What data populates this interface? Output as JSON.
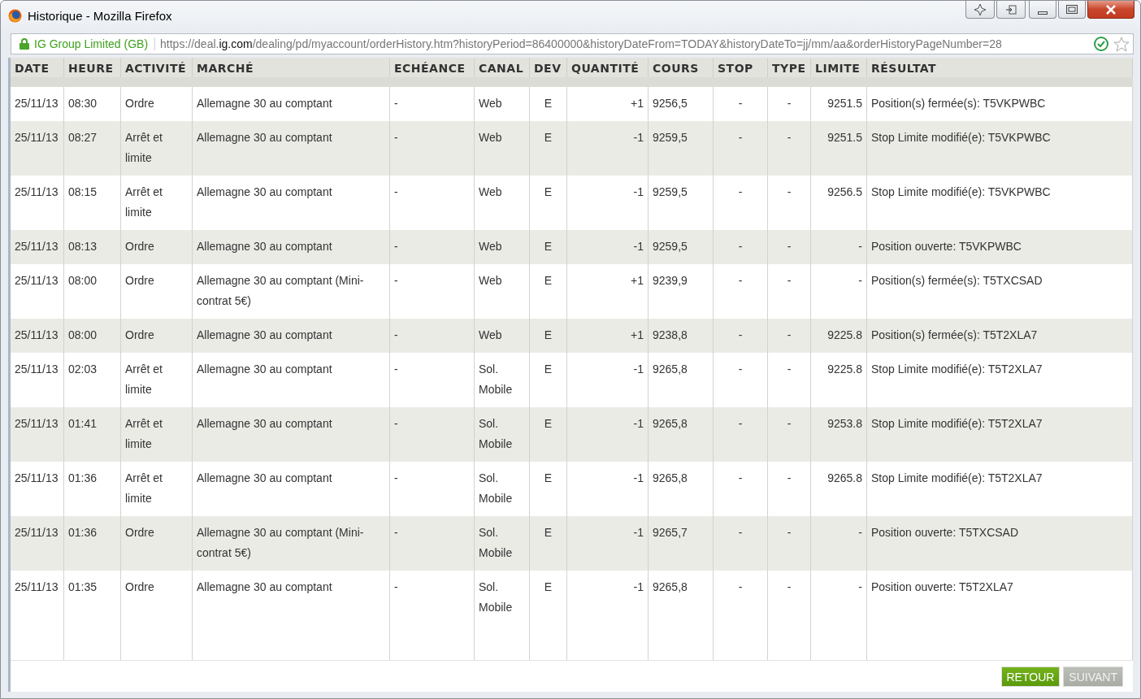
{
  "window": {
    "title": "Historique - Mozilla Firefox"
  },
  "address_bar": {
    "identity": "IG Group Limited (GB)",
    "url_start": "https://deal.",
    "url_domain": "ig.com",
    "url_rest": "/dealing/pd/myaccount/orderHistory.htm?historyPeriod=86400000&historyDateFrom=TODAY&historyDateTo=jj/mm/aa&orderHistoryPageNumber=28"
  },
  "table": {
    "columns": [
      "DATE",
      "HEURE",
      "ACTIVITÉ",
      "MARCHÉ",
      "ECHÉANCE",
      "CANAL",
      "DEV",
      "QUANTITÉ",
      "COURS",
      "STOP",
      "TYPE",
      "LIMITE",
      "RÉSULTAT"
    ],
    "rows": [
      [
        "25/11/13",
        "08:30",
        "Ordre",
        "Allemagne 30 au comptant",
        "-",
        "Web",
        "E",
        "+1",
        "9256,5",
        "-",
        "-",
        "9251.5",
        "Position(s) fermée(s): T5VKPWBC"
      ],
      [
        "25/11/13",
        "08:27",
        "Arrêt et limite",
        "Allemagne 30 au comptant",
        "-",
        "Web",
        "E",
        "-1",
        "9259,5",
        "-",
        "-",
        "9251.5",
        "Stop Limite modifié(e): T5VKPWBC"
      ],
      [
        "25/11/13",
        "08:15",
        "Arrêt et limite",
        "Allemagne 30 au comptant",
        "-",
        "Web",
        "E",
        "-1",
        "9259,5",
        "-",
        "-",
        "9256.5",
        "Stop Limite modifié(e): T5VKPWBC"
      ],
      [
        "25/11/13",
        "08:13",
        "Ordre",
        "Allemagne 30 au comptant",
        "-",
        "Web",
        "E",
        "-1",
        "9259,5",
        "-",
        "-",
        "-",
        "Position ouverte: T5VKPWBC"
      ],
      [
        "25/11/13",
        "08:00",
        "Ordre",
        "Allemagne 30 au comptant (Mini-contrat 5€)",
        "-",
        "Web",
        "E",
        "+1",
        "9239,9",
        "-",
        "-",
        "-",
        "Position(s) fermée(s): T5TXCSAD"
      ],
      [
        "25/11/13",
        "08:00",
        "Ordre",
        "Allemagne 30 au comptant",
        "-",
        "Web",
        "E",
        "+1",
        "9238,8",
        "-",
        "-",
        "9225.8",
        "Position(s) fermée(s): T5T2XLA7"
      ],
      [
        "25/11/13",
        "02:03",
        "Arrêt et limite",
        "Allemagne 30 au comptant",
        "-",
        "Sol. Mobile",
        "E",
        "-1",
        "9265,8",
        "-",
        "-",
        "9225.8",
        "Stop Limite modifié(e): T5T2XLA7"
      ],
      [
        "25/11/13",
        "01:41",
        "Arrêt et limite",
        "Allemagne 30 au comptant",
        "-",
        "Sol. Mobile",
        "E",
        "-1",
        "9265,8",
        "-",
        "-",
        "9253.8",
        "Stop Limite modifié(e): T5T2XLA7"
      ],
      [
        "25/11/13",
        "01:36",
        "Arrêt et limite",
        "Allemagne 30 au comptant",
        "-",
        "Sol. Mobile",
        "E",
        "-1",
        "9265,8",
        "-",
        "-",
        "9265.8",
        "Stop Limite modifié(e): T5T2XLA7"
      ],
      [
        "25/11/13",
        "01:36",
        "Ordre",
        "Allemagne 30 au comptant (Mini-contrat 5€)",
        "-",
        "Sol. Mobile",
        "E",
        "-1",
        "9265,7",
        "-",
        "-",
        "-",
        "Position ouverte: T5TXCSAD"
      ],
      [
        "25/11/13",
        "01:35",
        "Ordre",
        "Allemagne 30 au comptant",
        "-",
        "Sol. Mobile",
        "E",
        "-1",
        "9265,8",
        "-",
        "-",
        "-",
        "Position ouverte: T5T2XLA7"
      ]
    ]
  },
  "buttons": [
    {
      "label": "RETOUR",
      "disabled": false
    },
    {
      "label": "SUIVANT",
      "disabled": true
    }
  ]
}
